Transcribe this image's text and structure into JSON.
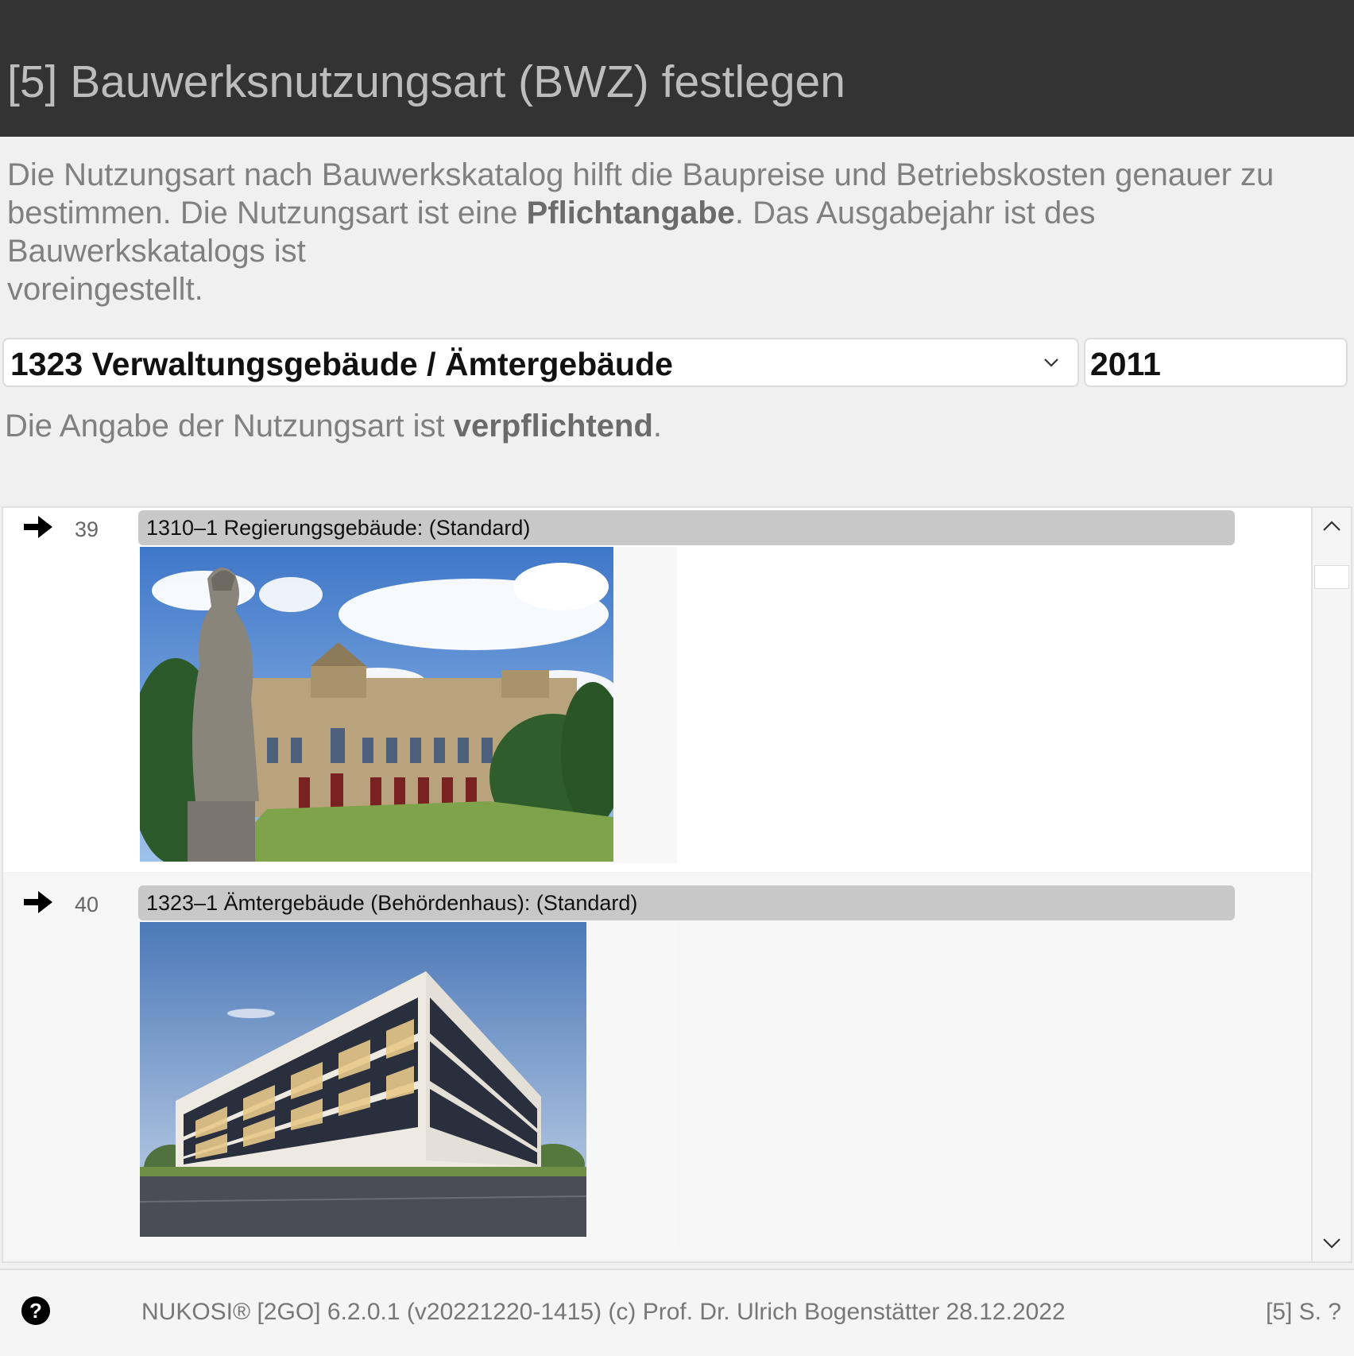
{
  "header": {
    "title": "[5] Bauwerksnutzungsart (BWZ) festlegen"
  },
  "intro": {
    "part1": "Die Nutzungsart nach Bauwerkskatalog hilft die Baupreise und Betriebskosten genauer zu bestimmen. Die Nutzungsart ist eine ",
    "bold": "Pflichtangabe",
    "part2": ". Das Ausgabejahr ist des Bauwerkskatalogs ist",
    "part3": "voreingestellt."
  },
  "selector": {
    "selected": "1323 Verwaltungsgebäude / Ämtergebäude",
    "year": "2011"
  },
  "warning": {
    "part1": "Die Angabe der Nutzungsart ist ",
    "bold": "verpflichtend",
    "part2": "."
  },
  "list": {
    "items": [
      {
        "number": "39",
        "label": "1310–1 Regierungsgebäude: (Standard)",
        "image": "government-building-photo"
      },
      {
        "number": "40",
        "label": "1323–1 Ämtergebäude (Behördenhaus): (Standard)",
        "image": "office-building-photo"
      }
    ]
  },
  "footer": {
    "text": "NUKOSI® [2GO] 6.2.0.1 (v20221220-1415) (c) Prof. Dr. Ulrich Bogenstätter  28.12.2022",
    "page": "[5] S. ?"
  },
  "icons": {
    "arrow": "arrow-right-icon",
    "help": "help-icon",
    "dropdown": "chevron-down-icon",
    "scroll_up": "chevron-up-icon",
    "scroll_down": "chevron-down-icon"
  },
  "colors": {
    "header_bg": "#333333",
    "header_text": "#bdbdbd",
    "body_text": "#808080",
    "label_bg": "#c8c8c8"
  }
}
